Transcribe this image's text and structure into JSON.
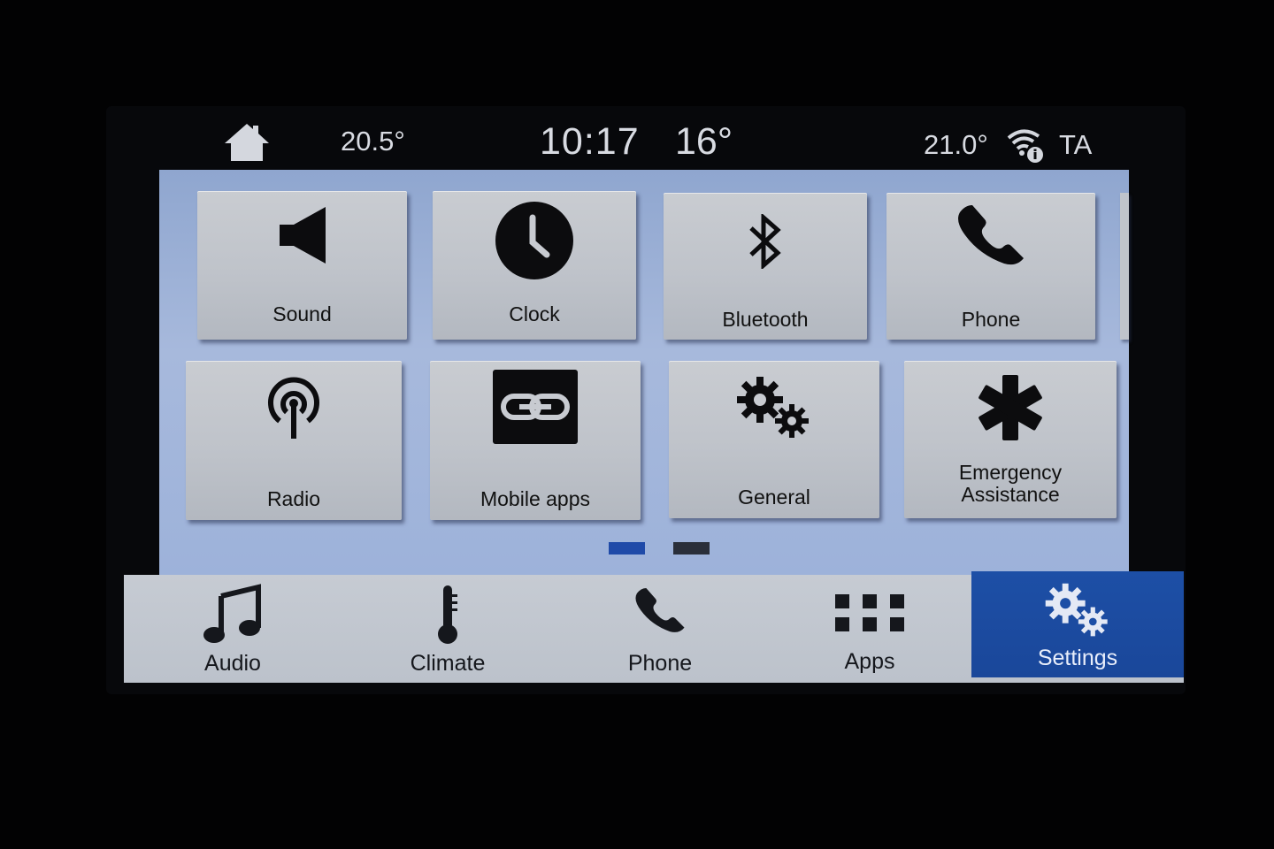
{
  "status_bar": {
    "temp_left": "20.5°",
    "time": "10:17",
    "outside_temp": "16°",
    "temp_right": "21.0°",
    "traffic": "TA"
  },
  "tiles": [
    {
      "label": "Sound",
      "icon": "speaker-icon"
    },
    {
      "label": "Clock",
      "icon": "clock-icon"
    },
    {
      "label": "Bluetooth",
      "icon": "bluetooth-icon"
    },
    {
      "label": "Phone",
      "icon": "phone-icon"
    },
    {
      "label": "Radio",
      "icon": "radio-icon"
    },
    {
      "label": "Mobile apps",
      "icon": "link-icon"
    },
    {
      "label": "General",
      "icon": "gears-icon"
    },
    {
      "label": "Emergency\nAssistance",
      "icon": "asterisk-icon"
    }
  ],
  "page_indicator": {
    "current": 1,
    "total": 2
  },
  "nav": [
    {
      "label": "Audio",
      "icon": "music-note-icon"
    },
    {
      "label": "Climate",
      "icon": "thermometer-icon"
    },
    {
      "label": "Phone",
      "icon": "phone-icon"
    },
    {
      "label": "Apps",
      "icon": "grid-icon"
    },
    {
      "label": "Settings",
      "icon": "gears-icon",
      "active": true
    }
  ],
  "colors": {
    "active_nav": "#1d4fa6",
    "dot_active": "#1f4aa8",
    "dot_inactive": "#2a2f3a"
  }
}
